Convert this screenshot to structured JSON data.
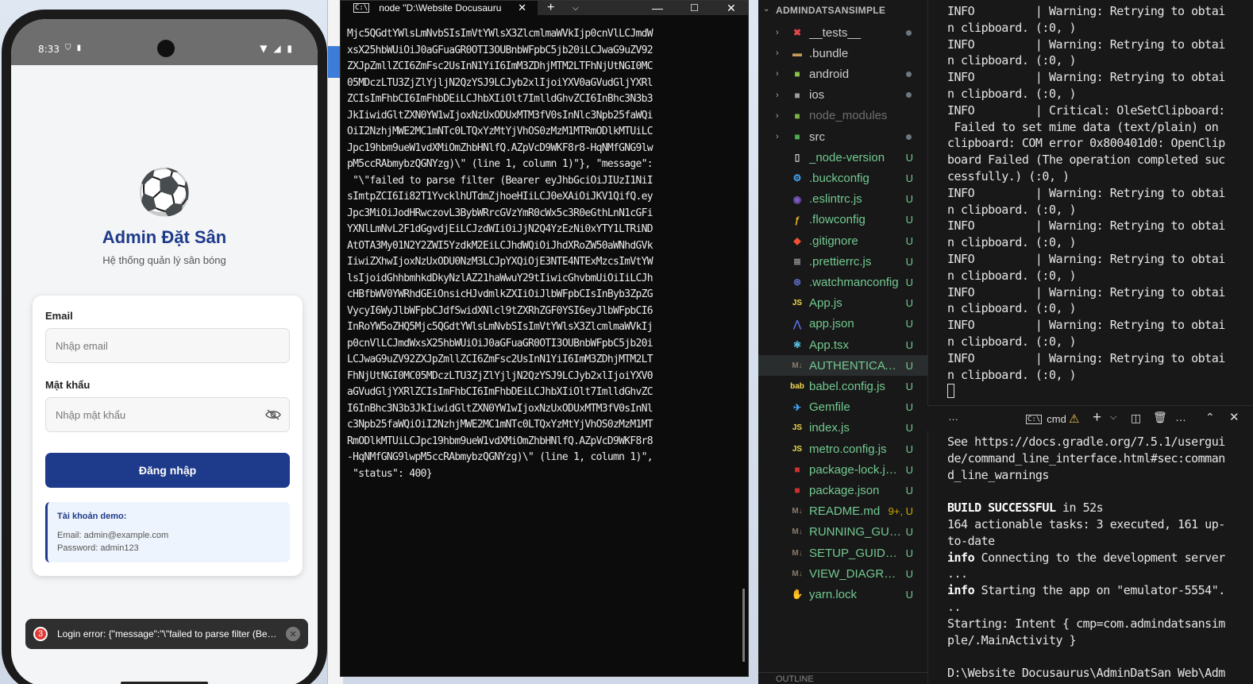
{
  "phone": {
    "status": {
      "time": "8:33",
      "left_icons": "⛉ ▮",
      "right_icons": "▼ ◢ ▮"
    },
    "app": {
      "logo": "⚽",
      "title": "Admin Đặt Sân",
      "subtitle": "Hệ thống quản lý sân bóng",
      "email_label": "Email",
      "email_placeholder": "Nhập email",
      "password_label": "Mật khẩu",
      "password_placeholder": "Nhập mật khẩu",
      "login_button": "Đăng nhập",
      "demo_title": "Tài khoản demo:",
      "demo_email": "Email: admin@example.com",
      "demo_password": "Password: admin123"
    },
    "toast": {
      "badge": "3",
      "text": "Login error: {\"message\":\"\\\"failed to parse filter (Bearer...",
      "close": "✕"
    }
  },
  "terminal": {
    "tab_icon": "C:\\",
    "tab_title": "node \"D:\\Website Docusauru",
    "tab_close": "✕",
    "new_tab": "+",
    "dropdown": "⌵",
    "minimize": "—",
    "maximize": "☐",
    "close": "✕",
    "lines": [
      "Mjc5QGdtYWlsLmNvbSIsImVtYWlsX3ZlcmlmaWVkIjp0cnVlLCJmdW",
      "xsX25hbWUiOiJ0aGFuaGR0OTI3OUBnbWFpbC5jb20iLCJwaG9uZV92",
      "ZXJpZmllZCI6ZmFsc2UsInN1YiI6ImM3ZDhjMTM2LTFhNjUtNGI0MC",
      "05MDczLTU3ZjZlYjljN2QzYSJ9LCJyb2xlIjoiYXV0aGVudGljYXRl",
      "ZCIsImFhbCI6ImFhbDEiLCJhbXIiOlt7ImlldGhvZCI6InBhc3N3b3",
      "JkIiwidGltZXN0YW1wIjoxNzUxODUxMTM3fV0sInNlc3Npb25faWQi",
      "OiI2NzhjMWE2MC1mNTc0LTQxYzMtYjVhOS0zMzM1MTRmODlkMTUiLC",
      "Jpc19hbm9ueW1vdXMiOmZhbHNlfQ.AZpVcD9WKF8r8-HqNMfGNG9lw",
      "pM5ccRAbmybzQGNYzg)\\\" (line 1, column 1)\"}, \"message\":",
      " \"\\\"failed to parse filter (Bearer eyJhbGciOiJIUzI1NiI",
      "sImtpZCI6Ii82T1YvcklhUTdmZjhoeHIiLCJ0eXAiOiJKV1QifQ.ey",
      "Jpc3MiOiJodHRwczovL3BybWRrcGVzYmR0cWx5c3R0eGthLnN1cGFi",
      "YXNlLmNvL2F1dGgvdjEiLCJzdWIiOiJjN2Q4YzEzNi0xYTY1LTRiND",
      "AtOTA3My01N2Y2ZWI5YzdkM2EiLCJhdWQiOiJhdXRoZW50aWNhdGVk",
      "IiwiZXhwIjoxNzUxODU0NzM3LCJpYXQiOjE3NTE4NTExMzcsImVtYW",
      "lsIjoidGhhbmhkdDkyNzlAZ21haWwuY29tIiwicGhvbmUiOiIiLCJh",
      "cHBfbWV0YWRhdGEiOnsicHJvdmlkZXIiOiJlbWFpbCIsInByb3ZpZG",
      "VycyI6WyJlbWFpbCJdfSwidXNlcl9tZXRhZGF0YSI6eyJlbWFpbCI6",
      "InRoYW5oZHQ5Mjc5QGdtYWlsLmNvbSIsImVtYWlsX3ZlcmlmaWVkIj",
      "p0cnVlLCJmdWxsX25hbWUiOiJ0aGFuaGR0OTI3OUBnbWFpbC5jb20i",
      "LCJwaG9uZV92ZXJpZmllZCI6ZmFsc2UsInN1YiI6ImM3ZDhjMTM2LT",
      "FhNjUtNGI0MC05MDczLTU3ZjZlYjljN2QzYSJ9LCJyb2xlIjoiYXV0",
      "aGVudGljYXRlZCIsImFhbCI6ImFhbDEiLCJhbXIiOlt7ImlldGhvZC",
      "I6InBhc3N3b3JkIiwidGltZXN0YW1wIjoxNzUxODUxMTM3fV0sInNl",
      "c3Npb25faWQiOiI2NzhjMWE2MC1mNTc0LTQxYzMtYjVhOS0zMzM1MT",
      "RmODlkMTUiLCJpc19hbm9ueW1vdXMiOmZhbHNlfQ.AZpVcD9WKF8r8",
      "-HqNMfGNG9lwpM5ccRAbmybzQGNYzg)\\\" (line 1, column 1)\",",
      " \"status\": 400}"
    ]
  },
  "explorer": {
    "root": "ADMINDATSANSIMPLE",
    "root_chevron": "⌄",
    "files": [
      {
        "name": "__tests__",
        "icon": "tests-folder-icon",
        "glyph": "✖",
        "color": "#e5484d",
        "chevron": "›",
        "status": "dot",
        "dim": false
      },
      {
        "name": ".bundle",
        "icon": "folder-icon",
        "glyph": "▬",
        "color": "#c59a5a",
        "chevron": "›",
        "status": "",
        "dim": false
      },
      {
        "name": "android",
        "icon": "android-folder-icon",
        "glyph": "■",
        "color": "#8bc34a",
        "chevron": "›",
        "status": "dot",
        "dim": false
      },
      {
        "name": "ios",
        "icon": "ios-folder-icon",
        "glyph": "■",
        "color": "#9e9e9e",
        "chevron": "›",
        "status": "dot",
        "dim": false
      },
      {
        "name": "node_modules",
        "icon": "node-folder-icon",
        "glyph": "■",
        "color": "#7cb342",
        "chevron": "›",
        "status": "",
        "dim": true
      },
      {
        "name": "src",
        "icon": "src-folder-icon",
        "glyph": "■",
        "color": "#4caf50",
        "chevron": "›",
        "status": "dot",
        "dim": false
      },
      {
        "name": "_node-version",
        "icon": "file-icon",
        "glyph": "▯",
        "color": "#cccccc",
        "chevron": "",
        "status": "U",
        "dim": false
      },
      {
        "name": ".buckconfig",
        "icon": "gear-file-icon",
        "glyph": "⚙",
        "color": "#42a5f5",
        "chevron": "",
        "status": "U",
        "dim": false
      },
      {
        "name": ".eslintrc.js",
        "icon": "eslint-icon",
        "glyph": "◉",
        "color": "#7e57c2",
        "chevron": "",
        "status": "U",
        "dim": false
      },
      {
        "name": ".flowconfig",
        "icon": "flow-icon",
        "glyph": "ƒ",
        "color": "#e6b422",
        "chevron": "",
        "status": "U",
        "dim": false
      },
      {
        "name": ".gitignore",
        "icon": "git-icon",
        "glyph": "◆",
        "color": "#f05133",
        "chevron": "",
        "status": "U",
        "dim": false
      },
      {
        "name": ".prettierrc.js",
        "icon": "prettier-icon",
        "glyph": "≣",
        "color": "#8e8e8e",
        "chevron": "",
        "status": "U",
        "dim": false
      },
      {
        "name": ".watchmanconfig",
        "icon": "watchman-icon",
        "glyph": "⊛",
        "color": "#5c6bc0",
        "chevron": "",
        "status": "U",
        "dim": false
      },
      {
        "name": "App.js",
        "icon": "js-file-icon",
        "glyph": "JS",
        "color": "#f0db4f",
        "chevron": "",
        "status": "U",
        "dim": false
      },
      {
        "name": "app.json",
        "icon": "json-file-icon",
        "glyph": "⋀",
        "color": "#5b6ee1",
        "chevron": "",
        "status": "U",
        "dim": false
      },
      {
        "name": "App.tsx",
        "icon": "react-file-icon",
        "glyph": "⚛",
        "color": "#61dafb",
        "chevron": "",
        "status": "U",
        "dim": false
      },
      {
        "name": "AUTHENTICATION.md",
        "icon": "markdown-file-icon",
        "glyph": "M↓",
        "color": "#8b7b6b",
        "chevron": "",
        "status": "U",
        "dim": false
      },
      {
        "name": "babel.config.js",
        "icon": "babel-icon",
        "glyph": "bab",
        "color": "#f5da55",
        "chevron": "",
        "status": "U",
        "dim": false
      },
      {
        "name": "Gemfile",
        "icon": "gem-file-icon",
        "glyph": "✈",
        "color": "#42a5f5",
        "chevron": "",
        "status": "U",
        "dim": false
      },
      {
        "name": "index.js",
        "icon": "js-file-icon",
        "glyph": "JS",
        "color": "#f0db4f",
        "chevron": "",
        "status": "U",
        "dim": false
      },
      {
        "name": "metro.config.js",
        "icon": "js-file-icon",
        "glyph": "JS",
        "color": "#f0db4f",
        "chevron": "",
        "status": "U",
        "dim": false
      },
      {
        "name": "package-lock.json",
        "icon": "npm-file-icon",
        "glyph": "■",
        "color": "#d32f2f",
        "chevron": "",
        "status": "U",
        "dim": false
      },
      {
        "name": "package.json",
        "icon": "npm-file-icon",
        "glyph": "■",
        "color": "#d32f2f",
        "chevron": "",
        "status": "U",
        "dim": false
      },
      {
        "name": "README.md",
        "icon": "markdown-file-icon",
        "glyph": "M↓",
        "color": "#8b7b6b",
        "chevron": "",
        "status": "9+, U",
        "dim": false
      },
      {
        "name": "RUNNING_GUIDE.md",
        "icon": "markdown-file-icon",
        "glyph": "M↓",
        "color": "#8b7b6b",
        "chevron": "",
        "status": "U",
        "dim": false
      },
      {
        "name": "SETUP_GUIDE.md",
        "icon": "markdown-file-icon",
        "glyph": "M↓",
        "color": "#8b7b6b",
        "chevron": "",
        "status": "U",
        "dim": false
      },
      {
        "name": "VIEW_DIAGRAM.md",
        "icon": "markdown-file-icon",
        "glyph": "M↓",
        "color": "#8b7b6b",
        "chevron": "",
        "status": "U",
        "dim": false
      },
      {
        "name": "yarn.lock",
        "icon": "yarn-file-icon",
        "glyph": "✋",
        "color": "#2c8ebb",
        "chevron": "",
        "status": "U",
        "dim": false
      }
    ],
    "outline": "OUTLINE"
  },
  "output_panel": {
    "lines": [
      "INFO         | Warning: Retrying to obtai",
      "n clipboard. (:0, )",
      "INFO         | Warning: Retrying to obtai",
      "n clipboard. (:0, )",
      "INFO         | Warning: Retrying to obtai",
      "n clipboard. (:0, )",
      "INFO         | Critical: OleSetClipboard:",
      " Failed to set mime data (text/plain) on",
      "clipboard: COM error 0x800401d0: OpenClip",
      "board Failed (The operation completed suc",
      "cessfully.) (:0, )",
      "INFO         | Warning: Retrying to obtai",
      "n clipboard. (:0, )",
      "INFO         | Warning: Retrying to obtai",
      "n clipboard. (:0, )",
      "INFO         | Warning: Retrying to obtai",
      "n clipboard. (:0, )",
      "INFO         | Warning: Retrying to obtai",
      "n clipboard. (:0, )",
      "INFO         | Warning: Retrying to obtai",
      "n clipboard. (:0, )",
      "INFO         | Warning: Retrying to obtai",
      "n clipboard. (:0, )"
    ]
  },
  "cmd_toolbar": {
    "more": "…",
    "tab_icon": "C:\\",
    "tab_label": "cmd",
    "warn": "⚠",
    "plus": "+",
    "plus_menu": "⌵",
    "split": "◫",
    "trash": "🗑",
    "dots": "…",
    "maximize": "⌃",
    "close": "✕"
  },
  "cmd_panel": {
    "lines_a": [
      "See https://docs.gradle.org/7.5.1/usergui",
      "de/command_line_interface.html#sec:comman",
      "d_line_warnings",
      ""
    ],
    "build_kw": "BUILD SUCCESSFUL",
    "build_rest": " in 52s",
    "lines_b": [
      "164 actionable tasks: 3 executed, 161 up-",
      "to-date"
    ],
    "info1_kw": "info",
    "info1_rest": " Connecting to the development server",
    "info1_cont": "...",
    "info2_kw": "info",
    "info2_rest": " Starting the app on \"emulator-5554\".",
    "info2_cont": "..",
    "lines_c": [
      "Starting: Intent { cmp=com.admindatsansim",
      "ple/.MainActivity }",
      "",
      "D:\\Website Docusaurus\\AdminDatSan Web\\Adm"
    ]
  }
}
